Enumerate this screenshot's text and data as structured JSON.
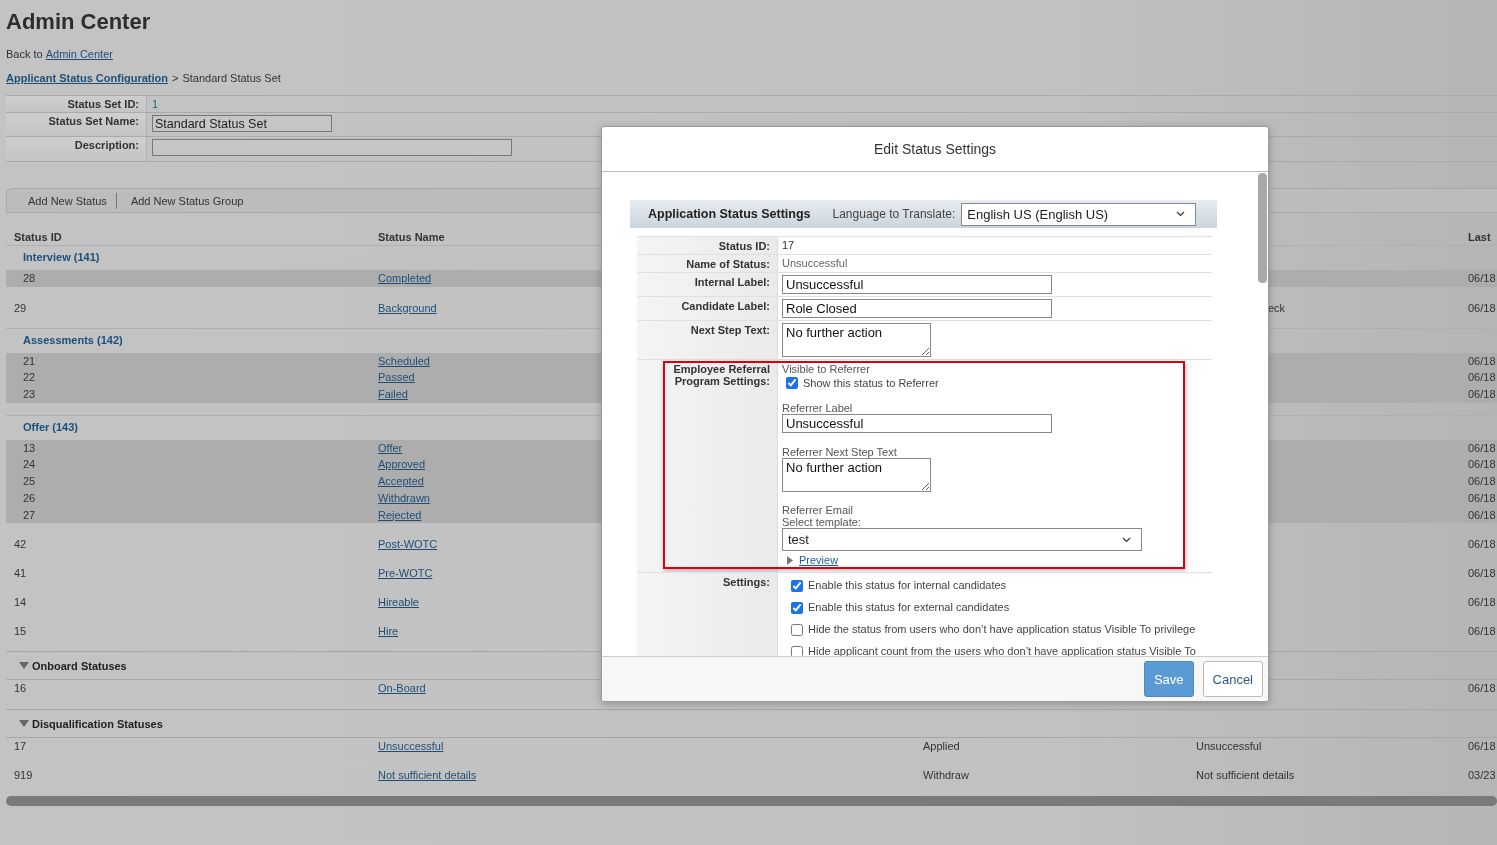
{
  "page": {
    "title": "Admin Center",
    "back_prefix": "Back to",
    "back_link": "Admin Center",
    "breadcrumb_link": "Applicant Status Configuration",
    "breadcrumb_separator": ">",
    "breadcrumb_current": "Standard Status Set"
  },
  "status_set": [
    {
      "label": "Status Set ID:",
      "kind": "text",
      "value": "1"
    },
    {
      "label": "Status Set Name:",
      "kind": "input",
      "value": "Standard Status Set"
    },
    {
      "label": "Description:",
      "kind": "input"
    }
  ],
  "toolbar": [
    "Add New Status",
    "Add New Status Group"
  ],
  "status_table": {
    "header": {
      "status_id": "Status ID",
      "status_name": "Status Name",
      "column_5": "Last"
    },
    "rows": [
      {
        "kind": "group",
        "label": "Interview (141)",
        "children": [
          {
            "id": "28",
            "name": "Completed",
            "column_5": "06/18"
          }
        ]
      },
      {
        "kind": "status",
        "id": "29",
        "name": "Background",
        "column_4": "eck",
        "column_4_clipped": true,
        "column_5": "06/18"
      },
      {
        "kind": "group",
        "label": "Assessments (142)",
        "children": [
          {
            "id": "21",
            "name": "Scheduled",
            "column_5": "06/18"
          },
          {
            "id": "22",
            "name": "Passed",
            "column_5": "06/18"
          },
          {
            "id": "23",
            "name": "Failed",
            "column_5": "06/18"
          }
        ]
      },
      {
        "kind": "group",
        "label": "Offer (143)",
        "children": [
          {
            "id": "13",
            "name": "Offer",
            "column_5": "06/18"
          },
          {
            "id": "24",
            "name": "Approved",
            "column_5": "06/18"
          },
          {
            "id": "25",
            "name": "Accepted",
            "column_5": "06/18"
          },
          {
            "id": "26",
            "name": "Withdrawn",
            "column_5": "06/18"
          },
          {
            "id": "27",
            "name": "Rejected",
            "column_5": "06/18"
          }
        ]
      },
      {
        "kind": "status",
        "id": "42",
        "name": "Post-WOTC",
        "column_5": "06/18"
      },
      {
        "kind": "status",
        "id": "41",
        "name": "Pre-WOTC",
        "column_5": "06/18"
      },
      {
        "kind": "status",
        "id": "14",
        "name": "Hireable",
        "column_5": "06/18"
      },
      {
        "kind": "status",
        "id": "15",
        "name": "Hire",
        "column_5": "06/18"
      },
      {
        "kind": "category",
        "label": "Onboard Statuses",
        "expanded": true,
        "children": [
          {
            "id": "16",
            "name": "On-Board",
            "column_5": "06/18"
          }
        ]
      },
      {
        "kind": "category",
        "label": "Disqualification Statuses",
        "expanded": true,
        "children": [
          {
            "id": "17",
            "name": "Unsuccessful",
            "column_3": "Applied",
            "column_4": "Unsuccessful",
            "column_5": "06/18"
          },
          {
            "id": "919",
            "name": "Not sufficient details",
            "column_3": "Withdraw",
            "column_4": "Not sufficient details",
            "column_5": "03/23"
          }
        ]
      }
    ]
  },
  "dialog": {
    "title": "Edit Status Settings",
    "section_title": "Application Status Settings",
    "language_label": "Language to Translate:",
    "language": "English US (English US)",
    "fields": [
      {
        "label": "Status ID:",
        "kind": "text",
        "value": "17"
      },
      {
        "label": "Name of Status:",
        "kind": "muted",
        "value": "Unsuccessful"
      },
      {
        "label": "Internal Label:",
        "kind": "input",
        "value": "Unsuccessful"
      },
      {
        "label": "Candidate Label:",
        "kind": "input",
        "value": "Role Closed"
      },
      {
        "label": "Next Step Text:",
        "kind": "textarea",
        "value": "No further action"
      }
    ],
    "referral": {
      "label": "Employee Referral Program Settings:",
      "highlighted": true,
      "visible_heading": "Visible to Referrer",
      "show_to_referrer": {
        "label": "Show this status to Referrer",
        "checked": true
      },
      "referrer_label_caption": "Referrer Label",
      "referrer_label": "Unsuccessful",
      "next_step_caption": "Referrer Next Step Text",
      "next_step": "No further action",
      "email_caption": "Referrer Email",
      "template_caption": "Select template:",
      "template": "test",
      "preview_link": "Preview"
    },
    "settings": {
      "label": "Settings:",
      "options": [
        {
          "label": "Enable this status for internal candidates",
          "checked": true
        },
        {
          "label": "Enable this status for external candidates",
          "checked": true
        },
        {
          "label": "Hide the status from users who don’t have application status Visible To privilege",
          "checked": false
        },
        {
          "label": "Hide applicant count from the users who don’t have application status Visible To",
          "checked": false
        }
      ]
    },
    "buttons": [
      {
        "label": "Save",
        "kind": "primary"
      },
      {
        "label": "Cancel",
        "kind": "secondary"
      }
    ]
  }
}
